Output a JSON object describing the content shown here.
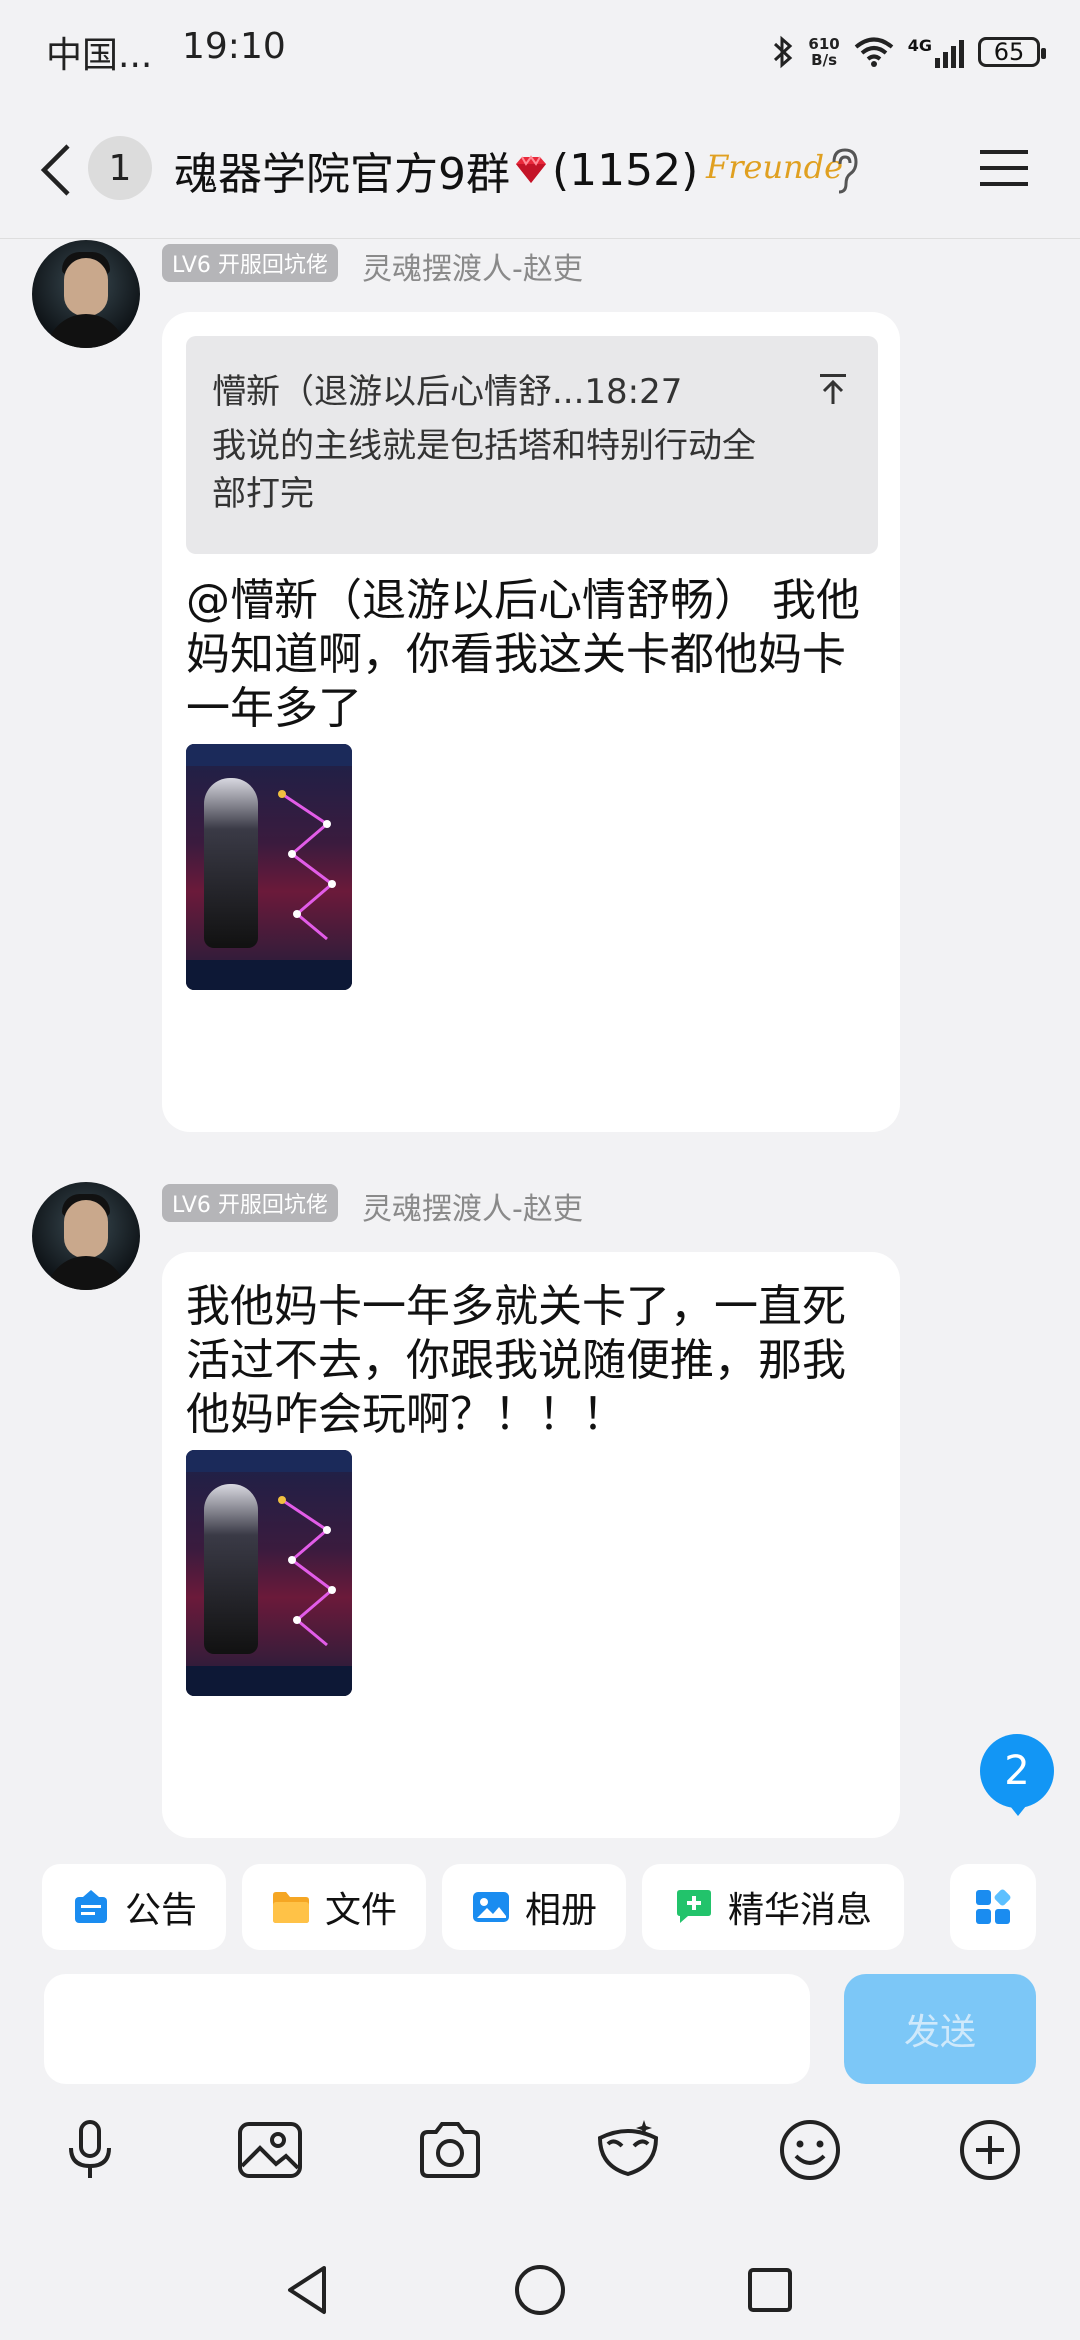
{
  "status_bar": {
    "carrier": "中国...",
    "time": "19:10",
    "net_speed_value": "610",
    "net_speed_unit": "B/s",
    "signal": "4G",
    "battery": "65"
  },
  "header": {
    "unread_count": "1",
    "title": "魂器学院官方9群",
    "member_count": "(1152)",
    "brand_badge": "Freunde"
  },
  "messages": [
    {
      "level_tag": "LV6 开服回坑佬",
      "sender": "灵魂摆渡人-赵吏",
      "quote": {
        "header": "懵新（退游以后心情舒...18:27",
        "text_line1": "我说的主线就是包括塔和特别行动全",
        "text_line2": "部打完"
      },
      "text_lines": [
        "@懵新（退游以后心情舒畅） 我他",
        "妈知道啊，你看我这关卡都他妈卡",
        "一年多了"
      ]
    },
    {
      "level_tag": "LV6 开服回坑佬",
      "sender": "灵魂摆渡人-赵吏",
      "text_lines": [
        "我他妈卡一年多就关卡了，一直死",
        "活过不去，你跟我说随便推，那我",
        "他妈咋会玩啊？！！！"
      ]
    }
  ],
  "new_message_badge": "2",
  "quick_actions": {
    "announcement": "公告",
    "files": "文件",
    "album": "相册",
    "featured": "精华消息"
  },
  "input": {
    "placeholder": "",
    "send_label": "发送"
  },
  "colors": {
    "accent": "#1296f5",
    "send_disabled": "#7cc7f7",
    "background": "#f2f2f4"
  }
}
